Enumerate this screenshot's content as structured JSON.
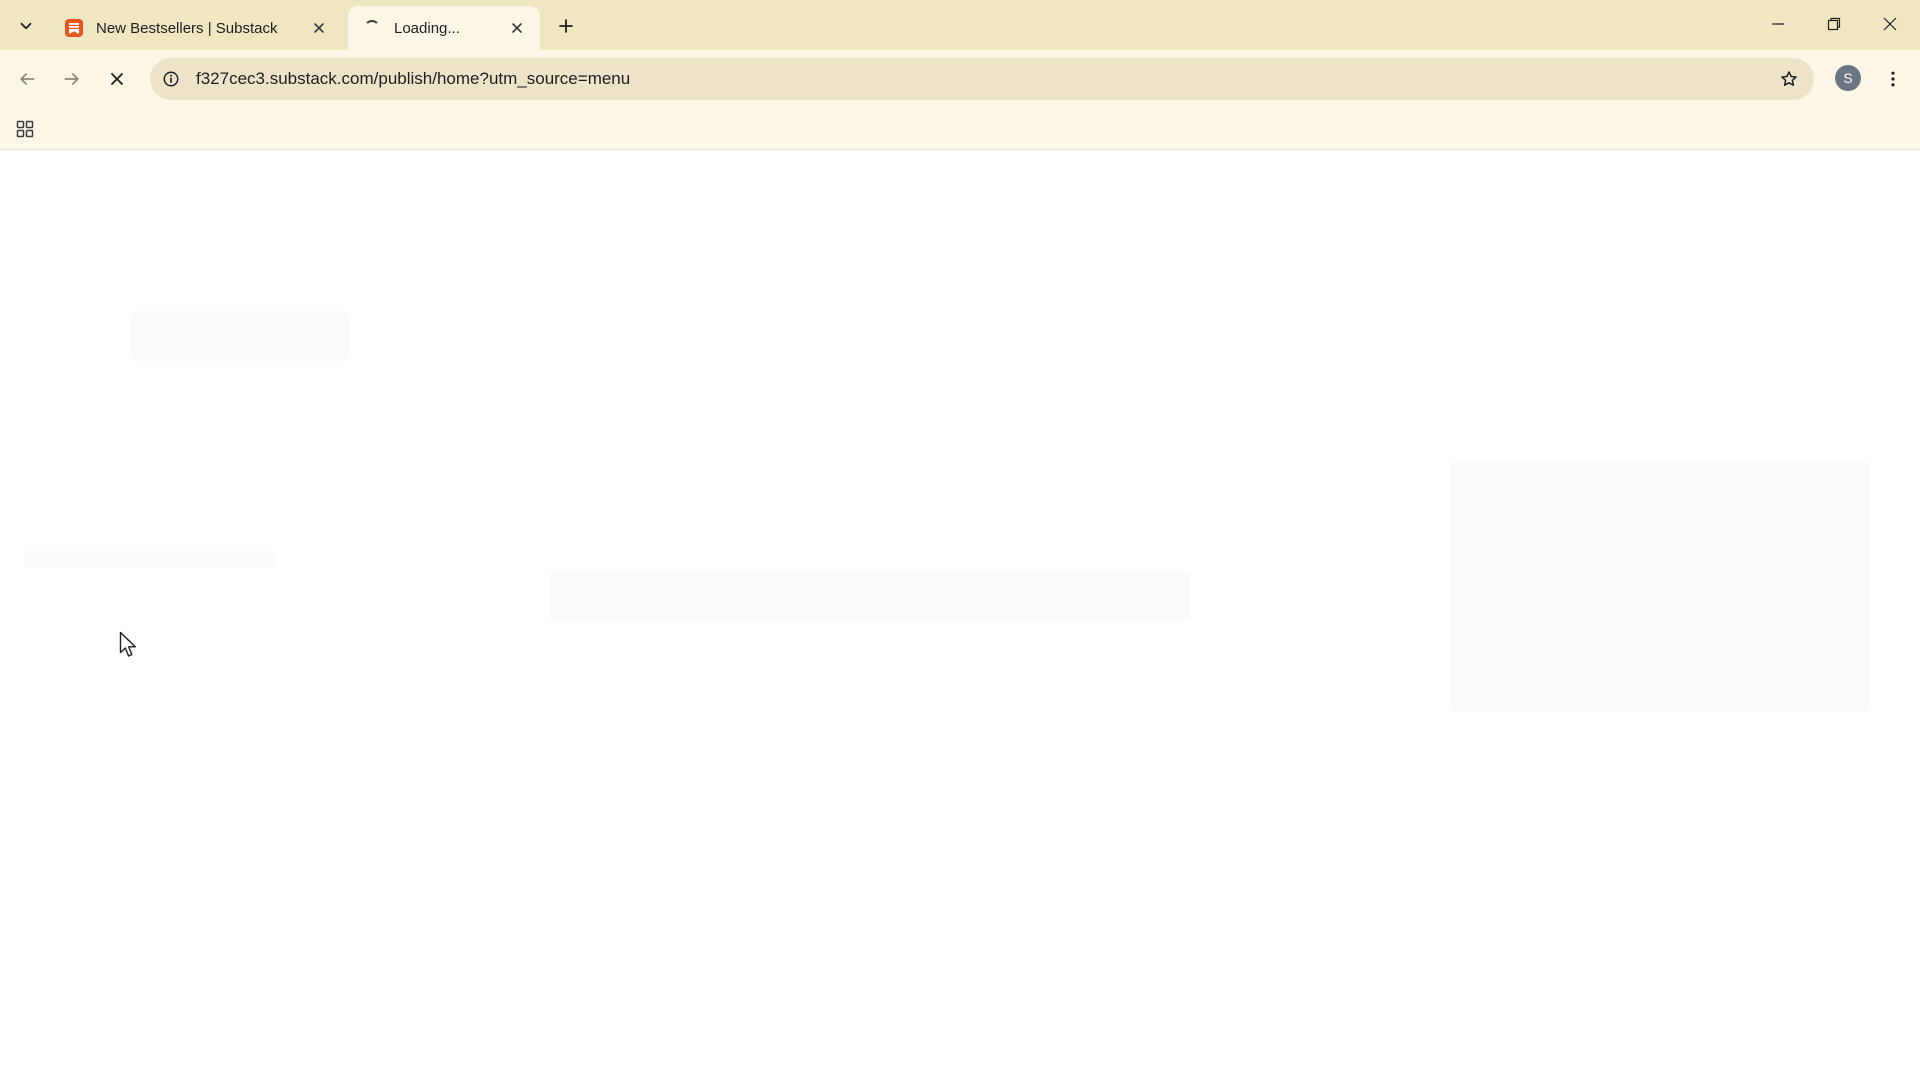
{
  "browser": {
    "tabs": [
      {
        "title": "New Bestsellers | Substack",
        "active": false,
        "favicon": "substack-logo-icon"
      },
      {
        "title": "Loading...",
        "active": true,
        "favicon": "loading-spinner-icon"
      }
    ],
    "address_bar": {
      "url": "f327cec3.substack.com/publish/home?utm_source=menu"
    },
    "profile": {
      "initial": "S"
    }
  },
  "colors": {
    "tabstrip_bg": "#efe6c2",
    "toolbar_bg": "#fbf6e6",
    "omnibox_bg": "#ece3c9",
    "substack_orange": "#e8561d"
  }
}
